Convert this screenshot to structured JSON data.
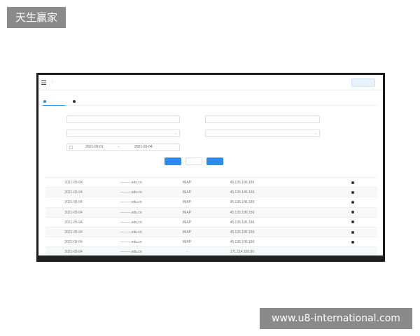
{
  "watermarks": {
    "top_left": "天生赢家",
    "bottom_right": "www.u8-international.com"
  },
  "header": {
    "breadcrumb": [
      "",
      ""
    ],
    "scope_label": "",
    "scope_value": "",
    "switch_label": ""
  },
  "tabs": [
    {
      "label": "",
      "active": true
    },
    {
      "label": "",
      "active": false
    }
  ],
  "form": {
    "account_label": "",
    "account_value": "",
    "login_ip_label": "",
    "login_ip_value": "",
    "ip_attr_label": "",
    "ip_attr_value": "",
    "block_label": "",
    "block_value": "",
    "time_label": "",
    "date_start": "2021-05-01",
    "date_sep": "-",
    "date_end": "2021-05-04"
  },
  "buttons": {
    "query": "",
    "reset": "",
    "export": ""
  },
  "table": {
    "headers": [
      "",
      "",
      "",
      "",
      "",
      ""
    ],
    "rows": [
      {
        "date": "2021-05-04",
        "email": "---------.edu.cn",
        "method": "IMAP",
        "ip": "45.135.186.186",
        "attr": "",
        "action": ""
      },
      {
        "date": "2021-05-04",
        "email": "---------.edu.cn",
        "method": "IMAP",
        "ip": "45.135.186.186",
        "attr": "",
        "action": ""
      },
      {
        "date": "2021-05-04",
        "email": "---------.edu.cn",
        "method": "IMAP",
        "ip": "45.135.186.186",
        "attr": "",
        "action": ""
      },
      {
        "date": "2021-05-04",
        "email": "---------.edu.cn",
        "method": "IMAP",
        "ip": "45.135.186.186",
        "attr": "",
        "action": ""
      },
      {
        "date": "2021-05-04",
        "email": "---------.edu.cn",
        "method": "IMAP",
        "ip": "45.135.186.186",
        "attr": "",
        "action": ""
      },
      {
        "date": "2021-05-04",
        "email": "---------.edu.cn",
        "method": "IMAP",
        "ip": "45.135.186.186",
        "attr": "",
        "action": ""
      },
      {
        "date": "2021-05-04",
        "email": "---------.edu.cn",
        "method": "IMAP",
        "ip": "45.135.186.186",
        "attr": "",
        "action": ""
      },
      {
        "date": "2021-05-04",
        "email": "---------.edu.cn",
        "method": "-",
        "ip": "171.114.100.80",
        "attr": "",
        "action": ""
      }
    ]
  },
  "colors": {
    "accent": "#2d8ceb",
    "scope_value": "#3cab5a"
  }
}
